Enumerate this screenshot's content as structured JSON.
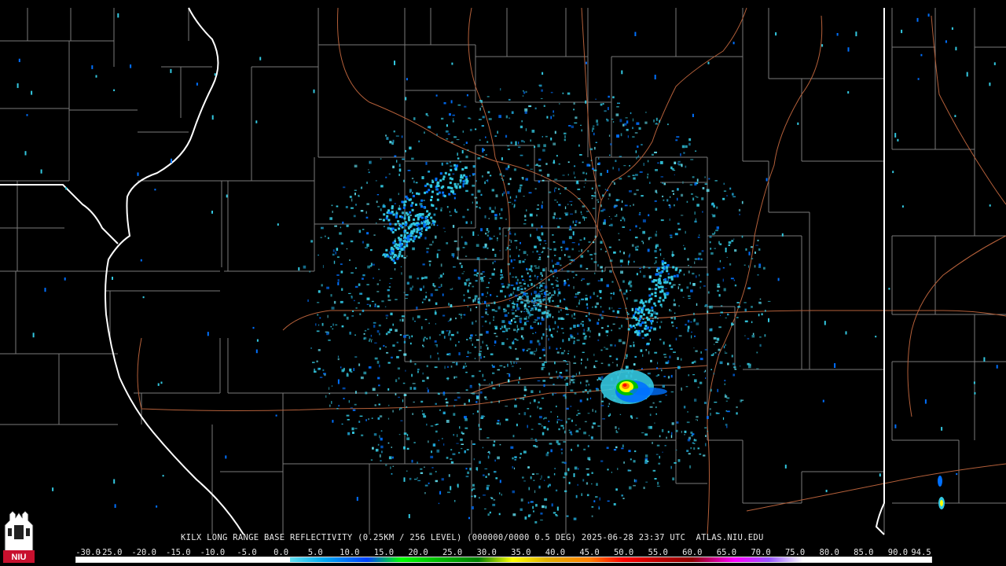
{
  "caption": "KILX LONG RANGE BASE REFLECTIVITY (0.25KM / 256 LEVEL) (000000/0000 0.5 DEG) 2025-06-28 23:37 UTC  ATLAS.NIU.EDU",
  "scale": {
    "labels": [
      "-30.0",
      "-25.0",
      "-20.0",
      "-15.0",
      "-10.0",
      "-5.0",
      "0.0",
      "5.0",
      "10.0",
      "15.0",
      "20.0",
      "25.0",
      "30.0",
      "35.0",
      "40.0",
      "45.0",
      "50.0",
      "55.0",
      "60.0",
      "65.0",
      "70.0",
      "75.0",
      "80.0",
      "85.0",
      "90.0",
      "94.5"
    ],
    "unit": ""
  },
  "logo": {
    "text": "NIU",
    "icon": "university-tower-logo"
  },
  "colors": {
    "background": "#000000",
    "county_lines": "#7a7a7a",
    "state_lines": "#ffffff",
    "highways": "#b5603a",
    "echo_light": "#33c8e0",
    "echo_medium": "#0070ff",
    "storm_core": "#ffff00"
  }
}
